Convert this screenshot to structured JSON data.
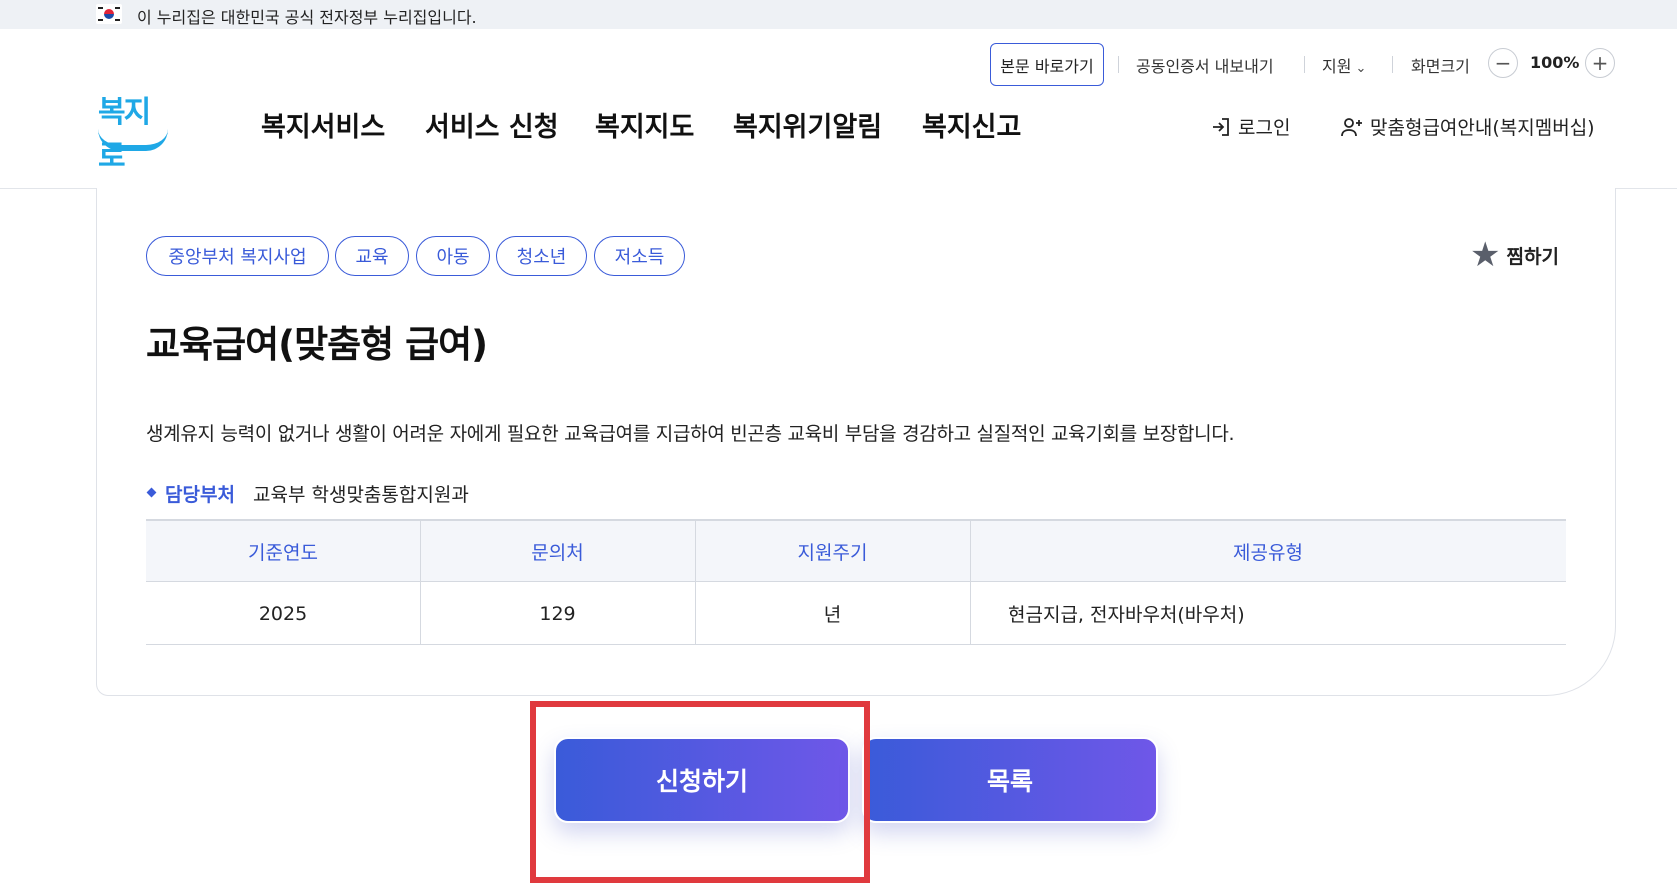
{
  "gov_banner": {
    "text": "이 누리집은 대한민국 공식 전자정부 누리집입니다."
  },
  "util": {
    "skip_label": "본문 바로가기",
    "cert_label": "공동인증서 내보내기",
    "support_label": "지원",
    "screen_size_label": "화면크기",
    "zoom_minus": "−",
    "zoom_value": "100%",
    "zoom_plus": "+"
  },
  "logo": {
    "text": "복지로"
  },
  "gnb": {
    "items": [
      {
        "label": "복지서비스"
      },
      {
        "label": "서비스 신청"
      },
      {
        "label": "복지지도"
      },
      {
        "label": "복지위기알림"
      },
      {
        "label": "복지신고"
      }
    ]
  },
  "auth": {
    "login_label": "로그인",
    "member_label": "맞춤형급여안내(복지멤버십)"
  },
  "detail": {
    "tags": [
      {
        "label": "중앙부처 복지사업"
      },
      {
        "label": "교육"
      },
      {
        "label": "아동"
      },
      {
        "label": "청소년"
      },
      {
        "label": "저소득"
      }
    ],
    "bookmark_label": "찜하기",
    "title": "교육급여(맞춤형 급여)",
    "description": "생계유지 능력이 없거나 생활이 어려운 자에게 필요한 교육급여를 지급하여 빈곤층 교육비 부담을 경감하고 실질적인 교육기회를 보장합니다.",
    "dept_label": "담당부처",
    "dept_value": "교육부 학생맞춤통합지원과",
    "table": {
      "headers": [
        "기준연도",
        "문의처",
        "지원주기",
        "제공유형"
      ],
      "row": [
        "2025",
        "129",
        "년",
        "현금지급, 전자바우처(바우처)"
      ]
    }
  },
  "actions": {
    "apply_label": "신청하기",
    "list_label": "목록"
  },
  "colors": {
    "accent": "#3a5bd9",
    "gradient_end": "#6f57e8",
    "highlight": "#e03a3e",
    "logo": "#1fa8e6"
  }
}
